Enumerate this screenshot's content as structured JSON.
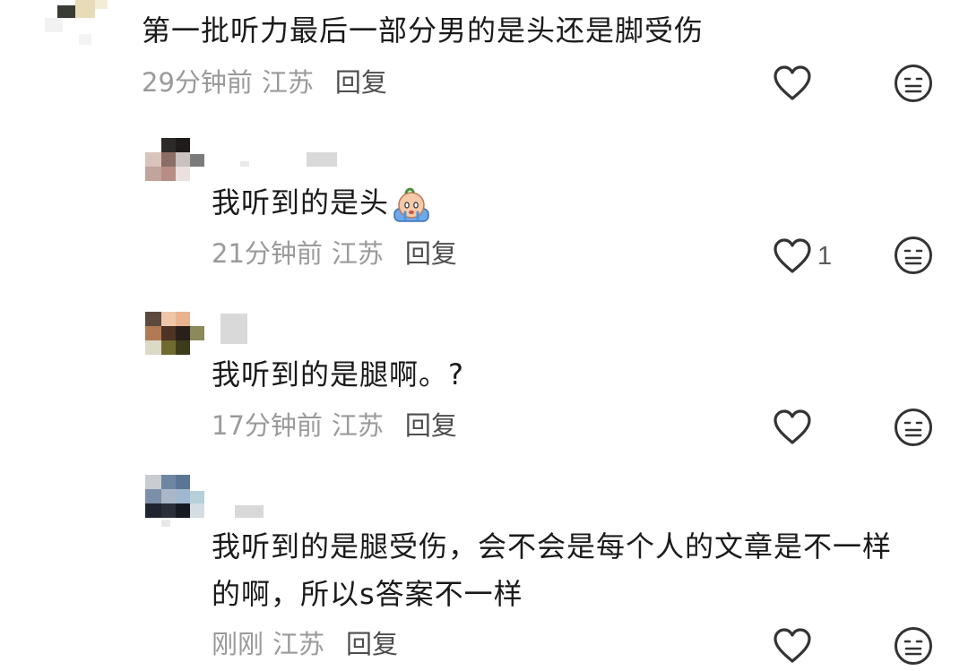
{
  "comments": [
    {
      "text": "第一批听力最后一部分男的是头还是脚受伤",
      "time": "29分钟前",
      "location": "江苏",
      "reply_label": "回复",
      "likes": ""
    },
    {
      "text": "我听到的是头",
      "emoji": "crying-face-emoji",
      "time": "21分钟前",
      "location": "江苏",
      "reply_label": "回复",
      "likes": "1"
    },
    {
      "text": "我听到的是腿啊。?",
      "time": "17分钟前",
      "location": "江苏",
      "reply_label": "回复",
      "likes": ""
    },
    {
      "text_line1": "我听到的是腿受伤，会不会是每个人的文章是不一样",
      "text_line2": "的啊，所以s答案不一样",
      "time": "刚刚",
      "location": "江苏",
      "reply_label": "回复",
      "likes": ""
    }
  ],
  "icons": {
    "like": "heart-outline-icon",
    "dislike": "neutral-face-icon"
  },
  "colors": {
    "text": "#1a1a1a",
    "meta": "#9a9a9a",
    "reply": "#4d4d4d",
    "icon": "#333333"
  }
}
